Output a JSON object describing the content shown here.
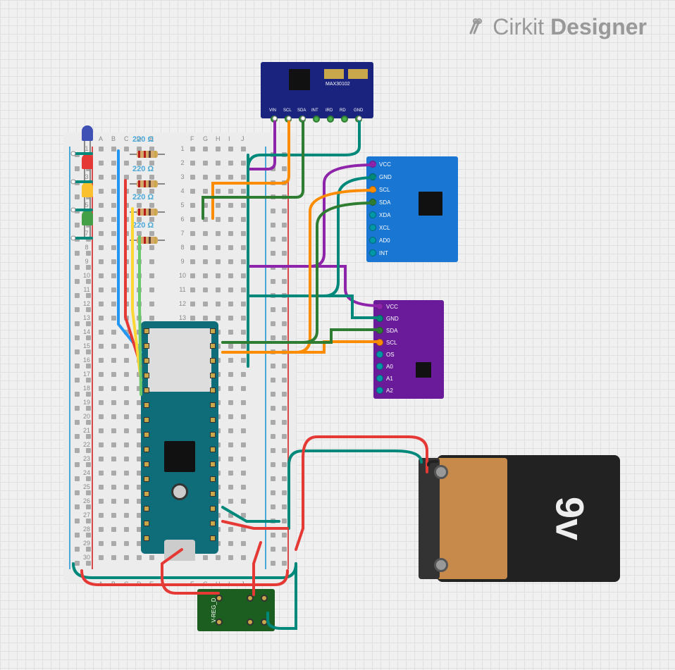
{
  "logo": {
    "brand1": "Cirkit ",
    "brand2": "Designer"
  },
  "breadboard": {
    "columns_left": [
      "A",
      "B",
      "C",
      "D",
      "E"
    ],
    "columns_right": [
      "F",
      "G",
      "H",
      "I",
      "J"
    ],
    "rows": 30
  },
  "resistors": {
    "value_label": "220 Ω",
    "count": 4
  },
  "leds": {
    "blue": "blue-led",
    "red": "red-led",
    "yellow": "yellow-led",
    "green": "green-led"
  },
  "components": {
    "max30102": {
      "name": "MAX30102",
      "pins": [
        "VIN",
        "SCL",
        "SDA",
        "INT",
        "IRD",
        "RD",
        "GND"
      ]
    },
    "mpu6050": {
      "pins": [
        {
          "label": "VCC",
          "color": "#8e24aa"
        },
        {
          "label": "GND",
          "color": "#00897b"
        },
        {
          "label": "SCL",
          "color": "#fb8c00"
        },
        {
          "label": "SDA",
          "color": "#2e7d32"
        },
        {
          "label": "XDA",
          "color": "#0097a7"
        },
        {
          "label": "XCL",
          "color": "#0097a7"
        },
        {
          "label": "AD0",
          "color": "#0097a7"
        },
        {
          "label": "INT",
          "color": "#0097a7"
        }
      ]
    },
    "lm75": {
      "pins": [
        {
          "label": "VCC",
          "color": "#8e24aa"
        },
        {
          "label": "GND",
          "color": "#00897b"
        },
        {
          "label": "SDA",
          "color": "#2e7d32"
        },
        {
          "label": "SCL",
          "color": "#fb8c00"
        },
        {
          "label": "OS",
          "color": "#0097a7"
        },
        {
          "label": "A0",
          "color": "#0097a7"
        },
        {
          "label": "A1",
          "color": "#0097a7"
        },
        {
          "label": "A2",
          "color": "#0097a7"
        }
      ]
    },
    "vreg": {
      "label": "V-REG_D"
    },
    "battery": {
      "label": "9v"
    }
  },
  "wire_colors": {
    "vcc_purple": "#8e24aa",
    "gnd_teal": "#00897b",
    "scl_orange": "#fb8c00",
    "sda_green": "#2e7d32",
    "red": "#e53935",
    "blue": "#2196f3",
    "yellow": "#fdd835",
    "lime": "#6bc96b",
    "dark": "#333"
  }
}
